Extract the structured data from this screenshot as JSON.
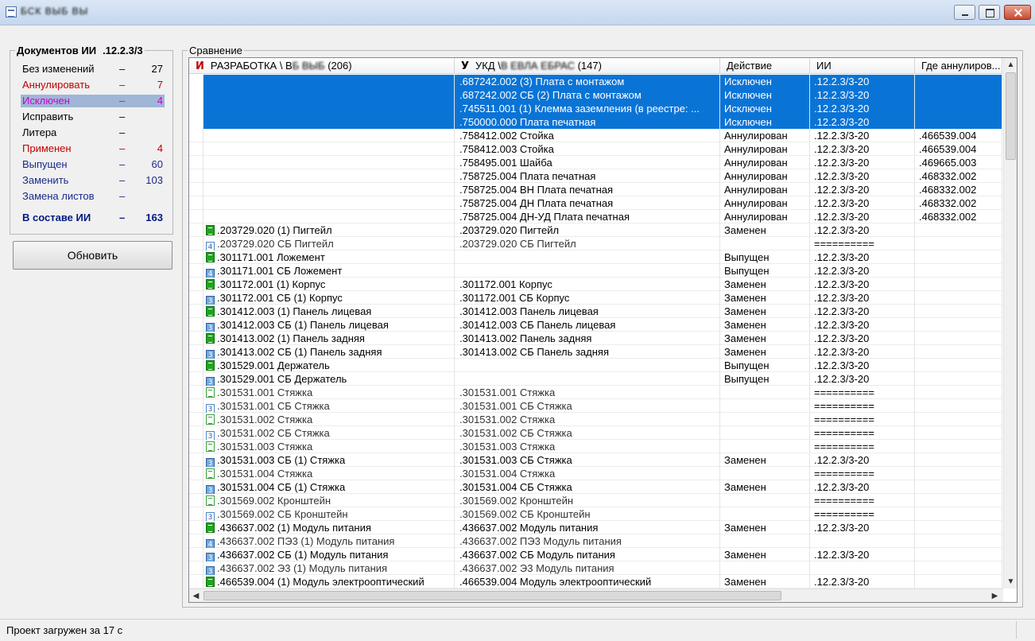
{
  "window": {
    "title": "БСК ВЫБ ВЫ"
  },
  "summary": {
    "title": "Документов ИИ",
    "id": ".12.2.3/3",
    "rows": [
      {
        "label": "Без изменений",
        "dash": "–",
        "count": "27",
        "color": "black"
      },
      {
        "label": "Аннулировать",
        "dash": "–",
        "count": "7",
        "color": "red"
      },
      {
        "label": "Исключен",
        "dash": "–",
        "count": "4",
        "color": "magenta",
        "highlight": true
      },
      {
        "label": "Исправить",
        "dash": "–",
        "count": "",
        "color": "black"
      },
      {
        "label": "Литера",
        "dash": "–",
        "count": "",
        "color": "black"
      },
      {
        "label": "Применен",
        "dash": "–",
        "count": "4",
        "color": "red"
      },
      {
        "label": "Выпущен",
        "dash": "–",
        "count": "60",
        "color": "navy"
      },
      {
        "label": "Заменить",
        "dash": "–",
        "count": "103",
        "color": "navy"
      },
      {
        "label": "Замена листов",
        "dash": "–",
        "count": "",
        "color": "navy"
      }
    ],
    "total": {
      "label": "В составе ИИ",
      "dash": "–",
      "count": "163"
    }
  },
  "refresh_button": "Обновить",
  "comparison": {
    "title": "Сравнение",
    "headers": {
      "col1_mark": "И",
      "col1": "РАЗРАБОТКА \\ В",
      "col1_blur": "Б ВЫБ",
      "col1_count": "(206)",
      "col2_mark": "У",
      "col2": "УКД \\",
      "col2_blur": "В ЕВЛА ЕБРАС",
      "col2_count": "(147)",
      "col3": "Действие",
      "col4": "ИИ",
      "col5": "Где аннулиров..."
    },
    "rows": [
      {
        "sel": true,
        "icon": "",
        "dev": "",
        "ukd": ".687242.002 (3)  Плата с монтажом",
        "action": "Исключен",
        "ii": ".12.2.3/3-20",
        "where": ""
      },
      {
        "sel": true,
        "icon": "",
        "dev": "",
        "ukd": ".687242.002 СБ (2)  Плата с монтажом",
        "action": "Исключен",
        "ii": ".12.2.3/3-20",
        "where": ""
      },
      {
        "sel": true,
        "icon": "",
        "dev": "",
        "ukd": ".745511.001 (1)  Клемма заземления (в реестре: ...",
        "action": "Исключен",
        "ii": ".12.2.3/3-20",
        "where": ""
      },
      {
        "sel": true,
        "icon": "",
        "dev": "",
        "ukd": ".750000.000  Плата печатная",
        "action": "Исключен",
        "ii": ".12.2.3/3-20",
        "where": ""
      },
      {
        "sel": false,
        "icon": "",
        "dev": "",
        "ukd": ".758412.002  Стойка",
        "action": "Аннулирован",
        "ii": ".12.2.3/3-20",
        "where": ".466539.004"
      },
      {
        "sel": false,
        "icon": "",
        "dev": "",
        "ukd": ".758412.003  Стойка",
        "action": "Аннулирован",
        "ii": ".12.2.3/3-20",
        "where": ".466539.004"
      },
      {
        "sel": false,
        "icon": "",
        "dev": "",
        "ukd": ".758495.001  Шайба",
        "action": "Аннулирован",
        "ii": ".12.2.3/3-20",
        "where": ".469665.003"
      },
      {
        "sel": false,
        "icon": "",
        "dev": "",
        "ukd": ".758725.004  Плата печатная",
        "action": "Аннулирован",
        "ii": ".12.2.3/3-20",
        "where": ".468332.002"
      },
      {
        "sel": false,
        "icon": "",
        "dev": "",
        "ukd": ".758725.004 ВН  Плата печатная",
        "action": "Аннулирован",
        "ii": ".12.2.3/3-20",
        "where": ".468332.002"
      },
      {
        "sel": false,
        "icon": "",
        "dev": "",
        "ukd": ".758725.004 ДН  Плата печатная",
        "action": "Аннулирован",
        "ii": ".12.2.3/3-20",
        "where": ".468332.002"
      },
      {
        "sel": false,
        "icon": "",
        "dev": "",
        "ukd": ".758725.004 ДН-УД  Плата печатная",
        "action": "Аннулирован",
        "ii": ".12.2.3/3-20",
        "where": ".468332.002"
      },
      {
        "sel": false,
        "icon": "g",
        "iconText": "",
        "dev": ".203729.020 (1)  Пигтейл",
        "ukd": ".203729.020  Пигтейл",
        "action": "Заменен",
        "ii": ".12.2.3/3-20",
        "where": ""
      },
      {
        "sel": false,
        "icon": "lb",
        "iconText": "4",
        "dim": true,
        "dev": ".203729.020 СБ  Пигтейл",
        "ukd": ".203729.020 СБ  Пигтейл",
        "action": "",
        "ii": "==========",
        "where": ""
      },
      {
        "sel": false,
        "icon": "g",
        "iconText": "",
        "dev": ".301171.001  Ложемент",
        "ukd": "",
        "action": "Выпущен",
        "ii": ".12.2.3/3-20",
        "where": ""
      },
      {
        "sel": false,
        "icon": "b",
        "iconText": "4",
        "dev": ".301171.001 СБ  Ложемент",
        "ukd": "",
        "action": "Выпущен",
        "ii": ".12.2.3/3-20",
        "where": ""
      },
      {
        "sel": false,
        "icon": "g",
        "iconText": "",
        "dev": ".301172.001 (1)  Корпус",
        "ukd": ".301172.001  Корпус",
        "action": "Заменен",
        "ii": ".12.2.3/3-20",
        "where": ""
      },
      {
        "sel": false,
        "icon": "b",
        "iconText": "3",
        "dev": ".301172.001 СБ (1)  Корпус",
        "ukd": ".301172.001 СБ  Корпус",
        "action": "Заменен",
        "ii": ".12.2.3/3-20",
        "where": ""
      },
      {
        "sel": false,
        "icon": "g",
        "iconText": "",
        "dev": ".301412.003 (1)  Панель лицевая",
        "ukd": ".301412.003  Панель лицевая",
        "action": "Заменен",
        "ii": ".12.2.3/3-20",
        "where": ""
      },
      {
        "sel": false,
        "icon": "b",
        "iconText": "3",
        "dev": ".301412.003 СБ (1)  Панель лицевая",
        "ukd": ".301412.003 СБ  Панель лицевая",
        "action": "Заменен",
        "ii": ".12.2.3/3-20",
        "where": ""
      },
      {
        "sel": false,
        "icon": "g",
        "iconText": "",
        "dev": ".301413.002 (1)  Панель задняя",
        "ukd": ".301413.002  Панель задняя",
        "action": "Заменен",
        "ii": ".12.2.3/3-20",
        "where": ""
      },
      {
        "sel": false,
        "icon": "b",
        "iconText": "3",
        "dev": ".301413.002 СБ (1)  Панель задняя",
        "ukd": ".301413.002 СБ  Панель задняя",
        "action": "Заменен",
        "ii": ".12.2.3/3-20",
        "where": ""
      },
      {
        "sel": false,
        "icon": "g",
        "iconText": "",
        "dev": ".301529.001  Держатель",
        "ukd": "",
        "action": "Выпущен",
        "ii": ".12.2.3/3-20",
        "where": ""
      },
      {
        "sel": false,
        "icon": "b",
        "iconText": "3",
        "dev": ".301529.001 СБ  Держатель",
        "ukd": "",
        "action": "Выпущен",
        "ii": ".12.2.3/3-20",
        "where": ""
      },
      {
        "sel": false,
        "icon": "lg",
        "iconText": "",
        "dim": true,
        "dev": ".301531.001  Стяжка",
        "ukd": ".301531.001  Стяжка",
        "action": "",
        "ii": "==========",
        "where": ""
      },
      {
        "sel": false,
        "icon": "lb",
        "iconText": "3",
        "dim": true,
        "dev": ".301531.001 СБ  Стяжка",
        "ukd": ".301531.001 СБ  Стяжка",
        "action": "",
        "ii": "==========",
        "where": ""
      },
      {
        "sel": false,
        "icon": "lg",
        "iconText": "",
        "dim": true,
        "dev": ".301531.002  Стяжка",
        "ukd": ".301531.002  Стяжка",
        "action": "",
        "ii": "==========",
        "where": ""
      },
      {
        "sel": false,
        "icon": "lb",
        "iconText": "3",
        "dim": true,
        "dev": ".301531.002 СБ  Стяжка",
        "ukd": ".301531.002 СБ  Стяжка",
        "action": "",
        "ii": "==========",
        "where": ""
      },
      {
        "sel": false,
        "icon": "lg",
        "iconText": "",
        "dim": true,
        "dev": ".301531.003  Стяжка",
        "ukd": ".301531.003  Стяжка",
        "action": "",
        "ii": "==========",
        "where": ""
      },
      {
        "sel": false,
        "icon": "b",
        "iconText": "3",
        "dev": ".301531.003 СБ (1)  Стяжка",
        "ukd": ".301531.003 СБ  Стяжка",
        "action": "Заменен",
        "ii": ".12.2.3/3-20",
        "where": ""
      },
      {
        "sel": false,
        "icon": "lg",
        "iconText": "",
        "dim": true,
        "dev": ".301531.004  Стяжка",
        "ukd": ".301531.004  Стяжка",
        "action": "",
        "ii": "==========",
        "where": ""
      },
      {
        "sel": false,
        "icon": "b",
        "iconText": "3",
        "dev": ".301531.004 СБ (1)  Стяжка",
        "ukd": ".301531.004 СБ  Стяжка",
        "action": "Заменен",
        "ii": ".12.2.3/3-20",
        "where": ""
      },
      {
        "sel": false,
        "icon": "lg",
        "iconText": "",
        "dim": true,
        "dev": ".301569.002  Кронштейн",
        "ukd": ".301569.002  Кронштейн",
        "action": "",
        "ii": "==========",
        "where": ""
      },
      {
        "sel": false,
        "icon": "lb",
        "iconText": "3",
        "dim": true,
        "dev": ".301569.002 СБ  Кронштейн",
        "ukd": ".301569.002 СБ  Кронштейн",
        "action": "",
        "ii": "==========",
        "where": ""
      },
      {
        "sel": false,
        "icon": "g",
        "iconText": "",
        "dev": ".436637.002 (1)  Модуль питания",
        "ukd": ".436637.002  Модуль питания",
        "action": "Заменен",
        "ii": ".12.2.3/3-20",
        "where": ""
      },
      {
        "sel": false,
        "icon": "b",
        "iconText": "4",
        "dim": true,
        "dev": ".436637.002 ПЭ3 (1)  Модуль питания",
        "ukd": ".436637.002 ПЭ3  Модуль питания",
        "action": "",
        "ii": "",
        "where": ""
      },
      {
        "sel": false,
        "icon": "b",
        "iconText": "3",
        "dev": ".436637.002 СБ (1)  Модуль питания",
        "ukd": ".436637.002 СБ  Модуль питания",
        "action": "Заменен",
        "ii": ".12.2.3/3-20",
        "where": ""
      },
      {
        "sel": false,
        "icon": "b",
        "iconText": "3",
        "dim": true,
        "dev": ".436637.002 Э3 (1)  Модуль питания",
        "ukd": ".436637.002 Э3  Модуль питания",
        "action": "",
        "ii": "",
        "where": ""
      },
      {
        "sel": false,
        "icon": "g",
        "iconText": "",
        "dev": ".466539.004 (1)  Модуль электрооптический",
        "ukd": ".466539.004  Модуль электрооптический",
        "action": "Заменен",
        "ii": ".12.2.3/3-20",
        "where": ""
      }
    ]
  },
  "statusbar": {
    "text": "Проект загружен за 17 с"
  },
  "icons": {
    "scroll_up": "▲",
    "scroll_down": "▼",
    "scroll_left": "◀",
    "scroll_right": "▶"
  }
}
